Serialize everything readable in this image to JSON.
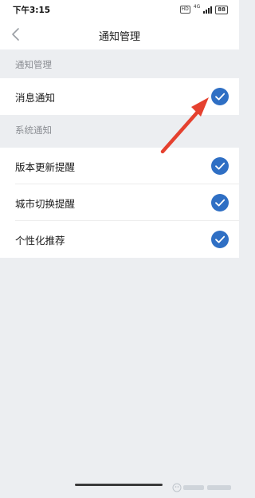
{
  "status_bar": {
    "time": "下午3:15",
    "hd": "HD",
    "network": "4G",
    "battery": "88"
  },
  "nav": {
    "title": "通知管理"
  },
  "sections": [
    {
      "header": "通知管理",
      "items": [
        {
          "label": "消息通知",
          "checked": true
        }
      ]
    },
    {
      "header": "系统通知",
      "items": [
        {
          "label": "版本更新提醒",
          "checked": true
        },
        {
          "label": "城市切换提醒",
          "checked": true
        },
        {
          "label": "个性化推荐",
          "checked": true
        }
      ]
    }
  ],
  "colors": {
    "accent": "#2f6fc4",
    "annotation_arrow": "#e5412f",
    "background": "#eceef1"
  }
}
